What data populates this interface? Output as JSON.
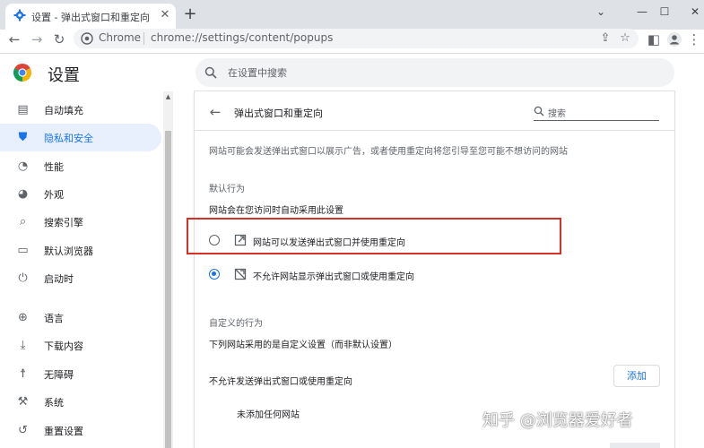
{
  "browser": {
    "tab": {
      "title": "设置 - 弹出式窗口和重定向",
      "close_glyph": "✕"
    },
    "new_tab_glyph": "+",
    "window_controls": {
      "collapse": "⌄",
      "minimize": "—",
      "maximize": "☐",
      "close": "✕"
    },
    "toolbar": {
      "back_glyph": "←",
      "forward_glyph": "→",
      "reload_glyph": "↻",
      "origin_label": "Chrome",
      "url": "chrome://settings/content/popups",
      "share_glyph": "⇪",
      "bookmark_glyph": "☆",
      "sidepanel_glyph": "◧",
      "menu_glyph": "⋮"
    }
  },
  "header": {
    "title": "设置",
    "search_placeholder": "在设置中搜索"
  },
  "sidebar": {
    "items": [
      {
        "label": "自动填充",
        "icon": "clipboard-icon",
        "glyph": "▤"
      },
      {
        "label": "隐私和安全",
        "icon": "shield-icon",
        "glyph": "⛊",
        "active": true
      },
      {
        "label": "性能",
        "icon": "gauge-icon",
        "glyph": "◔"
      },
      {
        "label": "外观",
        "icon": "palette-icon",
        "glyph": "◕"
      },
      {
        "label": "搜索引擎",
        "icon": "search-icon",
        "glyph": "⌕"
      },
      {
        "label": "默认浏览器",
        "icon": "browser-icon",
        "glyph": "▭"
      },
      {
        "label": "启动时",
        "icon": "power-icon",
        "glyph": "⏻"
      },
      {
        "label": "语言",
        "icon": "globe-icon",
        "glyph": "⊕"
      },
      {
        "label": "下载内容",
        "icon": "download-icon",
        "glyph": "⤓"
      },
      {
        "label": "无障碍",
        "icon": "accessibility-icon",
        "glyph": "☨"
      },
      {
        "label": "系统",
        "icon": "wrench-icon",
        "glyph": "⚒"
      },
      {
        "label": "重置设置",
        "icon": "restore-icon",
        "glyph": "↺"
      }
    ]
  },
  "content": {
    "back_glyph": "←",
    "title": "弹出式窗口和重定向",
    "search_label": "搜索",
    "description": "网站可能会发送弹出式窗口以展示广告，或者使用重定向将您引导至您可能不想访问的网站",
    "default_behavior": {
      "heading": "默认行为",
      "subheading": "网站会在您访问时自动采用此设置",
      "options": [
        {
          "label": "网站可以发送弹出式窗口并使用重定向",
          "selected": false,
          "icon": "open-external-icon"
        },
        {
          "label": "不允许网站显示弹出式窗口或使用重定向",
          "selected": true,
          "icon": "popup-blocked-icon"
        }
      ]
    },
    "custom_behavior": {
      "heading": "自定义的行为",
      "subheading": "下列网站采用的是自定义设置（而非默认设置）",
      "block_list_label": "不允许发送弹出式窗口或使用重定向",
      "add_button": "添加",
      "empty_text": "未添加任何网站"
    }
  },
  "watermark": "知乎 @浏览器爱好者",
  "colors": {
    "accent": "#1a73e8",
    "highlight_border": "#d93025",
    "active_nav_bg": "#e8f0fe",
    "tabstrip_bg": "#dee1e6"
  }
}
